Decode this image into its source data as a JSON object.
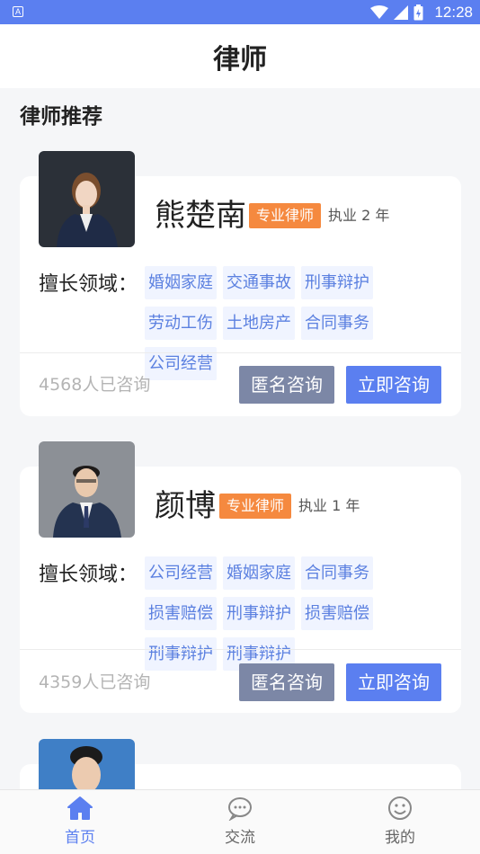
{
  "status_bar": {
    "time": "12:28",
    "app_icon_letter": "A"
  },
  "header": {
    "title": "律师"
  },
  "section": {
    "title": "律师推荐"
  },
  "lawyers": [
    {
      "name": "熊楚南",
      "title": "专业律师",
      "years": "执业 2 年",
      "expertise_label": "擅长领域：",
      "tags": [
        "婚姻家庭",
        "交通事故",
        "刑事辩护",
        "劳动工伤",
        "土地房产",
        "合同事务",
        "公司经营"
      ],
      "consult_count": "4568人已咨询",
      "anon_button": "匿名咨询",
      "consult_button": "立即咨询"
    },
    {
      "name": "颜博",
      "title": "专业律师",
      "years": "执业 1 年",
      "expertise_label": "擅长领域：",
      "tags": [
        "公司经营",
        "婚姻家庭",
        "合同事务",
        "损害赔偿",
        "刑事辩护",
        "损害赔偿",
        "刑事辩护",
        "刑事辩护"
      ],
      "consult_count": "4359人已咨询",
      "anon_button": "匿名咨询",
      "consult_button": "立即咨询"
    }
  ],
  "tab_bar": {
    "items": [
      {
        "label": "首页",
        "icon": "home-icon",
        "active": true
      },
      {
        "label": "交流",
        "icon": "chat-icon",
        "active": false
      },
      {
        "label": "我的",
        "icon": "smile-icon",
        "active": false
      }
    ]
  },
  "colors": {
    "primary": "#5b7ff0",
    "badge": "#f5893f",
    "anon_button": "#7c87a6",
    "tag_bg": "#f0f4ff",
    "tag_text": "#5b80e0"
  }
}
